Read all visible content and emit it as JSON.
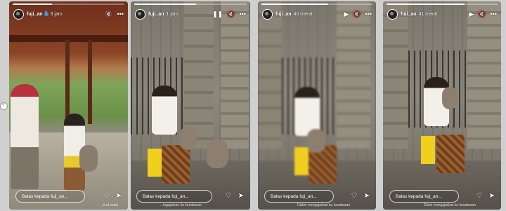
{
  "stories": [
    {
      "username": "fuji_an",
      "time": "3 jam",
      "verified": true,
      "progress": 0.35,
      "reply_placeholder": "Balas kepada fuji_an...",
      "caption": "...it al sokai",
      "top_icons": [
        "sound-off-icon",
        "more-icon"
      ]
    },
    {
      "username": "fuji_an",
      "time": "1 jam",
      "verified": false,
      "progress": 0.55,
      "reply_placeholder": "Balas kepada fuji_an...",
      "caption": "...ingajarkan ku kesabaran",
      "top_icons": [
        "pause-icon",
        "sound-off-icon",
        "more-icon"
      ]
    },
    {
      "username": "fuji_an",
      "time": "40 menit",
      "verified": false,
      "progress": 0.6,
      "reply_placeholder": "Balas kepada fuji_an...",
      "caption": "Dislini mengajarkan ku kesabaran",
      "top_icons": [
        "play-icon",
        "sound-off-icon",
        "more-icon"
      ]
    },
    {
      "username": "fuji_an",
      "time": "41 menit",
      "verified": false,
      "progress": 0.7,
      "reply_placeholder": "Balas kepada fuji_an...",
      "caption": "Disini mengajarkan ku kesabaran",
      "top_icons": [
        "play-icon",
        "sound-off-icon",
        "more-icon"
      ]
    }
  ],
  "icons": {
    "pause": "❚❚",
    "play": "▶",
    "sound_off": "🔇",
    "more": "•••",
    "heart": "♡",
    "send": "➤"
  }
}
